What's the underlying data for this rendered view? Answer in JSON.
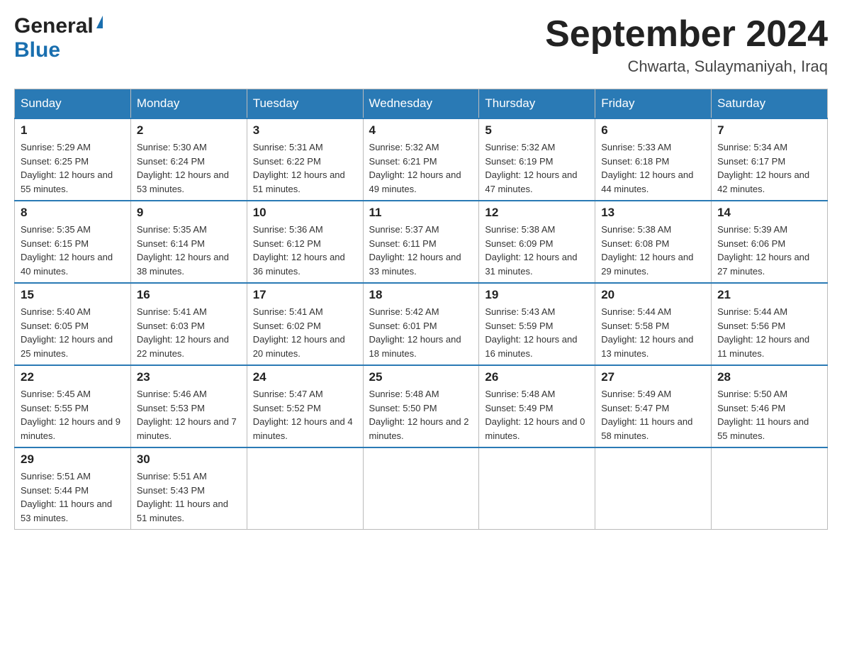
{
  "header": {
    "logo_general": "General",
    "logo_blue": "Blue",
    "month_title": "September 2024",
    "location": "Chwarta, Sulaymaniyah, Iraq"
  },
  "days_of_week": [
    "Sunday",
    "Monday",
    "Tuesday",
    "Wednesday",
    "Thursday",
    "Friday",
    "Saturday"
  ],
  "weeks": [
    [
      {
        "day": "1",
        "sunrise": "Sunrise: 5:29 AM",
        "sunset": "Sunset: 6:25 PM",
        "daylight": "Daylight: 12 hours and 55 minutes."
      },
      {
        "day": "2",
        "sunrise": "Sunrise: 5:30 AM",
        "sunset": "Sunset: 6:24 PM",
        "daylight": "Daylight: 12 hours and 53 minutes."
      },
      {
        "day": "3",
        "sunrise": "Sunrise: 5:31 AM",
        "sunset": "Sunset: 6:22 PM",
        "daylight": "Daylight: 12 hours and 51 minutes."
      },
      {
        "day": "4",
        "sunrise": "Sunrise: 5:32 AM",
        "sunset": "Sunset: 6:21 PM",
        "daylight": "Daylight: 12 hours and 49 minutes."
      },
      {
        "day": "5",
        "sunrise": "Sunrise: 5:32 AM",
        "sunset": "Sunset: 6:19 PM",
        "daylight": "Daylight: 12 hours and 47 minutes."
      },
      {
        "day": "6",
        "sunrise": "Sunrise: 5:33 AM",
        "sunset": "Sunset: 6:18 PM",
        "daylight": "Daylight: 12 hours and 44 minutes."
      },
      {
        "day": "7",
        "sunrise": "Sunrise: 5:34 AM",
        "sunset": "Sunset: 6:17 PM",
        "daylight": "Daylight: 12 hours and 42 minutes."
      }
    ],
    [
      {
        "day": "8",
        "sunrise": "Sunrise: 5:35 AM",
        "sunset": "Sunset: 6:15 PM",
        "daylight": "Daylight: 12 hours and 40 minutes."
      },
      {
        "day": "9",
        "sunrise": "Sunrise: 5:35 AM",
        "sunset": "Sunset: 6:14 PM",
        "daylight": "Daylight: 12 hours and 38 minutes."
      },
      {
        "day": "10",
        "sunrise": "Sunrise: 5:36 AM",
        "sunset": "Sunset: 6:12 PM",
        "daylight": "Daylight: 12 hours and 36 minutes."
      },
      {
        "day": "11",
        "sunrise": "Sunrise: 5:37 AM",
        "sunset": "Sunset: 6:11 PM",
        "daylight": "Daylight: 12 hours and 33 minutes."
      },
      {
        "day": "12",
        "sunrise": "Sunrise: 5:38 AM",
        "sunset": "Sunset: 6:09 PM",
        "daylight": "Daylight: 12 hours and 31 minutes."
      },
      {
        "day": "13",
        "sunrise": "Sunrise: 5:38 AM",
        "sunset": "Sunset: 6:08 PM",
        "daylight": "Daylight: 12 hours and 29 minutes."
      },
      {
        "day": "14",
        "sunrise": "Sunrise: 5:39 AM",
        "sunset": "Sunset: 6:06 PM",
        "daylight": "Daylight: 12 hours and 27 minutes."
      }
    ],
    [
      {
        "day": "15",
        "sunrise": "Sunrise: 5:40 AM",
        "sunset": "Sunset: 6:05 PM",
        "daylight": "Daylight: 12 hours and 25 minutes."
      },
      {
        "day": "16",
        "sunrise": "Sunrise: 5:41 AM",
        "sunset": "Sunset: 6:03 PM",
        "daylight": "Daylight: 12 hours and 22 minutes."
      },
      {
        "day": "17",
        "sunrise": "Sunrise: 5:41 AM",
        "sunset": "Sunset: 6:02 PM",
        "daylight": "Daylight: 12 hours and 20 minutes."
      },
      {
        "day": "18",
        "sunrise": "Sunrise: 5:42 AM",
        "sunset": "Sunset: 6:01 PM",
        "daylight": "Daylight: 12 hours and 18 minutes."
      },
      {
        "day": "19",
        "sunrise": "Sunrise: 5:43 AM",
        "sunset": "Sunset: 5:59 PM",
        "daylight": "Daylight: 12 hours and 16 minutes."
      },
      {
        "day": "20",
        "sunrise": "Sunrise: 5:44 AM",
        "sunset": "Sunset: 5:58 PM",
        "daylight": "Daylight: 12 hours and 13 minutes."
      },
      {
        "day": "21",
        "sunrise": "Sunrise: 5:44 AM",
        "sunset": "Sunset: 5:56 PM",
        "daylight": "Daylight: 12 hours and 11 minutes."
      }
    ],
    [
      {
        "day": "22",
        "sunrise": "Sunrise: 5:45 AM",
        "sunset": "Sunset: 5:55 PM",
        "daylight": "Daylight: 12 hours and 9 minutes."
      },
      {
        "day": "23",
        "sunrise": "Sunrise: 5:46 AM",
        "sunset": "Sunset: 5:53 PM",
        "daylight": "Daylight: 12 hours and 7 minutes."
      },
      {
        "day": "24",
        "sunrise": "Sunrise: 5:47 AM",
        "sunset": "Sunset: 5:52 PM",
        "daylight": "Daylight: 12 hours and 4 minutes."
      },
      {
        "day": "25",
        "sunrise": "Sunrise: 5:48 AM",
        "sunset": "Sunset: 5:50 PM",
        "daylight": "Daylight: 12 hours and 2 minutes."
      },
      {
        "day": "26",
        "sunrise": "Sunrise: 5:48 AM",
        "sunset": "Sunset: 5:49 PM",
        "daylight": "Daylight: 12 hours and 0 minutes."
      },
      {
        "day": "27",
        "sunrise": "Sunrise: 5:49 AM",
        "sunset": "Sunset: 5:47 PM",
        "daylight": "Daylight: 11 hours and 58 minutes."
      },
      {
        "day": "28",
        "sunrise": "Sunrise: 5:50 AM",
        "sunset": "Sunset: 5:46 PM",
        "daylight": "Daylight: 11 hours and 55 minutes."
      }
    ],
    [
      {
        "day": "29",
        "sunrise": "Sunrise: 5:51 AM",
        "sunset": "Sunset: 5:44 PM",
        "daylight": "Daylight: 11 hours and 53 minutes."
      },
      {
        "day": "30",
        "sunrise": "Sunrise: 5:51 AM",
        "sunset": "Sunset: 5:43 PM",
        "daylight": "Daylight: 11 hours and 51 minutes."
      },
      null,
      null,
      null,
      null,
      null
    ]
  ]
}
